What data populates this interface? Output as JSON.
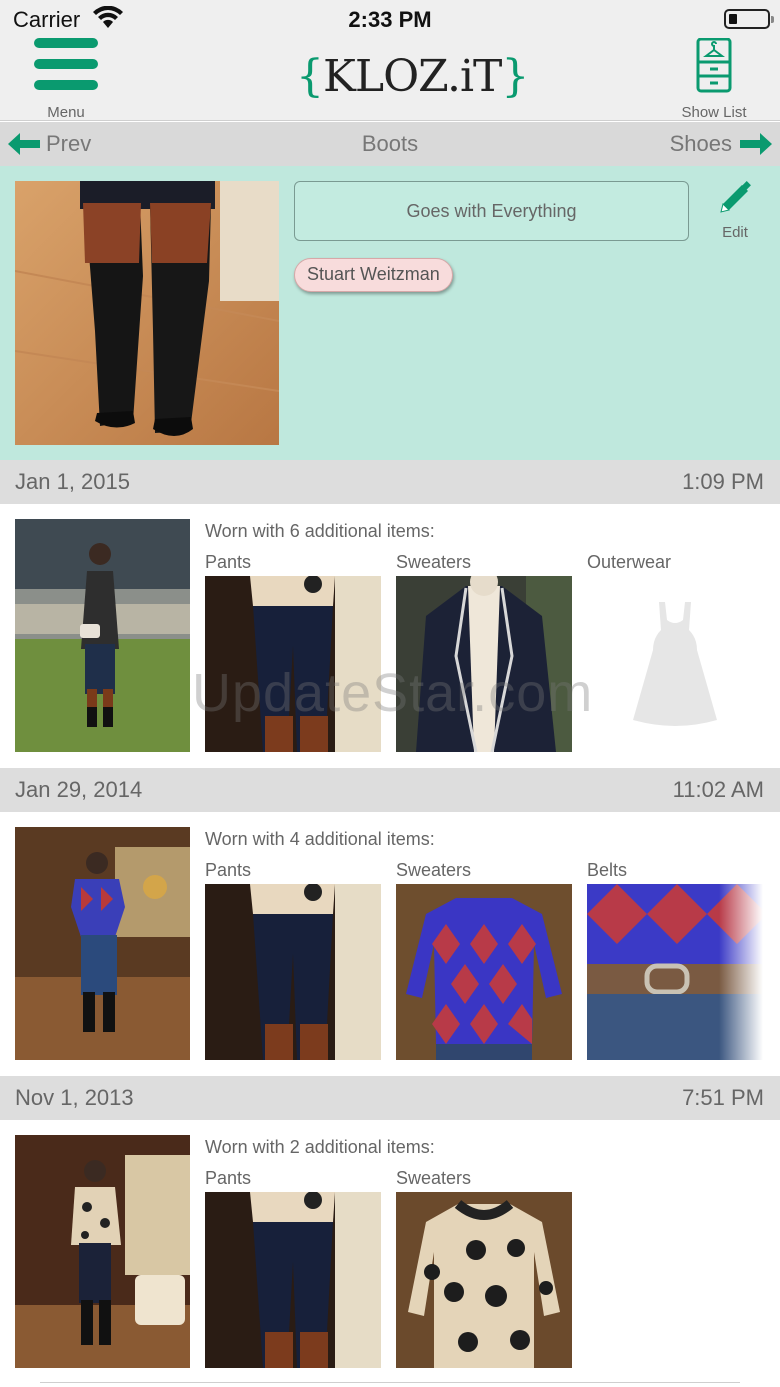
{
  "status": {
    "carrier": "Carrier",
    "time": "2:33 PM"
  },
  "header": {
    "menu_label": "Menu",
    "logo_left_brace": "{",
    "logo_text": "KLOZ.iT",
    "logo_right_brace": "}",
    "show_list_label": "Show List"
  },
  "nav": {
    "prev_label": "Prev",
    "title": "Boots",
    "next_label": "Shoes"
  },
  "detail": {
    "tag": "Goes with Everything",
    "edit_label": "Edit",
    "brand": "Stuart Weitzman"
  },
  "entries": [
    {
      "date": "Jan 1, 2015",
      "time": "1:09 PM",
      "worn_with": "Worn with 6 additional items:",
      "categories": [
        "Pants",
        "Sweaters",
        "Outerwear"
      ]
    },
    {
      "date": "Jan 29, 2014",
      "time": "11:02 AM",
      "worn_with": "Worn with 4 additional items:",
      "categories": [
        "Pants",
        "Sweaters",
        "Belts"
      ]
    },
    {
      "date": "Nov 1, 2013",
      "time": "7:51 PM",
      "worn_with": "Worn with 2 additional items:",
      "categories": [
        "Pants",
        "Sweaters"
      ]
    }
  ],
  "watermark": "UpdateStar.com",
  "colors": {
    "accent": "#0a9a6f",
    "detail_bg": "#bfe8dd",
    "header_bg": "#efefef",
    "section_bg": "#dddddd"
  },
  "icons": {
    "menu": "hamburger-icon",
    "show_list": "wardrobe-icon",
    "prev": "arrow-left-icon",
    "next": "arrow-right-icon",
    "edit": "pencil-icon",
    "placeholder": "dress-placeholder-icon"
  }
}
